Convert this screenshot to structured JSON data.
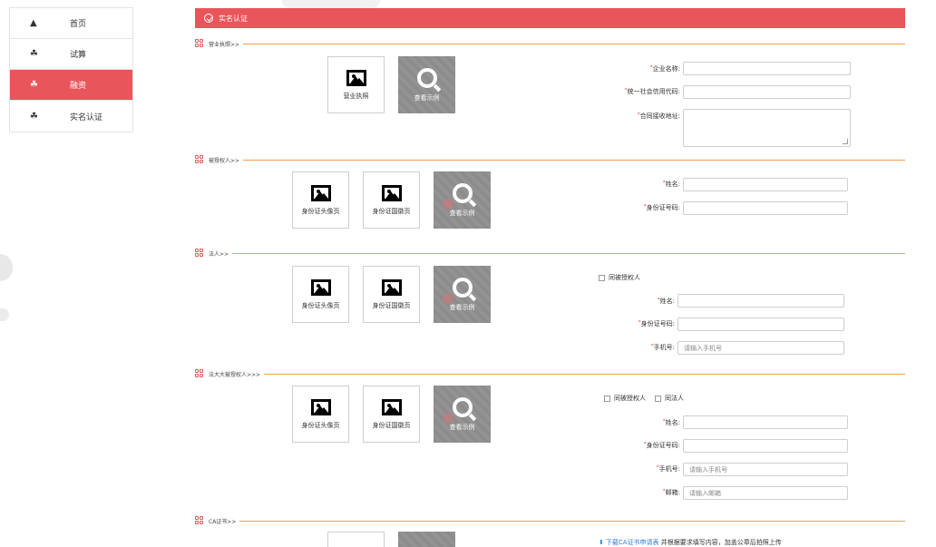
{
  "sidebar": {
    "items": [
      {
        "label": "首页",
        "icon": "home-icon"
      },
      {
        "label": "试算",
        "icon": "hand-money-icon"
      },
      {
        "label": "融资",
        "icon": "hand-money-icon",
        "active": true
      },
      {
        "label": "实名认证",
        "icon": "hand-money-icon"
      }
    ]
  },
  "header": {
    "title": "实名认证",
    "color": "#e8555a"
  },
  "sections": {
    "business": {
      "title": "营业执照>>"
    },
    "authorized": {
      "title": "被授权人>>"
    },
    "legal": {
      "title": "法人>>"
    },
    "fadada": {
      "title": "法大大被授权人>>>"
    },
    "ca": {
      "title": "CA证书>>"
    }
  },
  "uploads": {
    "license": "营业执照",
    "id_front": "身份证头像页",
    "id_back": "身份证国徽页",
    "example": "查看示例"
  },
  "business_form": {
    "company_name": "企业名称:",
    "credit_code": "统一社会信用代码:",
    "contract_address": "合同接收地址:"
  },
  "authorized_form": {
    "name": "姓名:",
    "id_number": "身份证号码:"
  },
  "legal_form": {
    "same_as": "同被授权人",
    "name": "姓名:",
    "id_number": "身份证号码:",
    "phone": "手机号:",
    "phone_placeholder": "请输入手机号"
  },
  "fadada_form": {
    "same_as_authorized": "同被授权人",
    "same_as_legal": "同法人",
    "name": "姓名:",
    "id_number": "身份证号码:",
    "phone": "手机号:",
    "phone_placeholder": "请输入手机号",
    "email": "邮箱:",
    "email_placeholder": "请输入邮箱"
  },
  "ca": {
    "download_link": "下载CA证书申请表",
    "instruction": " 并根据要求填写内容，加盖公章后拍照上传"
  },
  "required_mark": "*"
}
